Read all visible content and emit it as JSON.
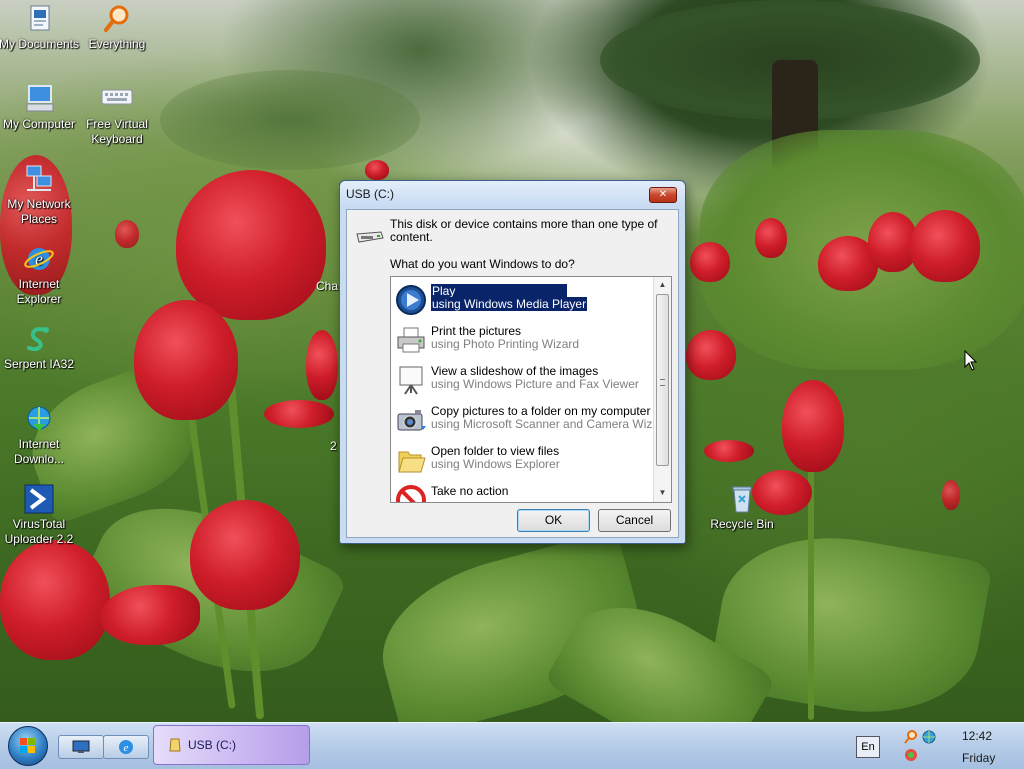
{
  "desktop": {
    "icons": [
      {
        "label": "My Documents",
        "icon": "documents-icon"
      },
      {
        "label": "Everything",
        "icon": "magnifier-icon"
      },
      {
        "label": "My Computer",
        "icon": "computer-icon"
      },
      {
        "label": "Free Virtual Keyboard",
        "icon": "keyboard-icon"
      },
      {
        "label": "My Network Places",
        "icon": "network-icon"
      },
      {
        "label": "Internet Explorer",
        "icon": "ie-icon"
      },
      {
        "label": "Serpent IA32",
        "icon": "serpent-icon"
      },
      {
        "label": "Internet Downlo...",
        "icon": "download-manager-icon"
      },
      {
        "label": "VirusTotal Uploader 2.2",
        "icon": "virustotal-icon"
      },
      {
        "label": "Recycle Bin",
        "icon": "recycle-bin-icon"
      }
    ],
    "partial_labels": [
      "Cha",
      "2"
    ]
  },
  "dialog": {
    "title": "USB (C:)",
    "close_label": "✕",
    "intro": "This disk or device contains more than one type of content.",
    "question": "What do you want Windows to do?",
    "actions": [
      {
        "title": "Play",
        "subtitle": "using Windows Media Player",
        "icon": "media-player-icon",
        "selected": true
      },
      {
        "title": "Print the pictures",
        "subtitle": "using Photo Printing Wizard",
        "icon": "printer-icon",
        "selected": false
      },
      {
        "title": "View a slideshow of the images",
        "subtitle": "using Windows Picture and Fax Viewer",
        "icon": "slideshow-icon",
        "selected": false
      },
      {
        "title": "Copy pictures to a folder on my computer",
        "subtitle": "using Microsoft Scanner and Camera Wizard",
        "icon": "camera-icon",
        "selected": false
      },
      {
        "title": "Open folder to view files",
        "subtitle": "using Windows Explorer",
        "icon": "folder-icon",
        "selected": false
      },
      {
        "title": "Take no action",
        "subtitle": "",
        "icon": "no-action-icon",
        "selected": false
      }
    ],
    "ok_label": "OK",
    "cancel_label": "Cancel"
  },
  "taskbar": {
    "task_label": "USB (C:)",
    "language": "En",
    "clock_time": "12:42",
    "clock_day": "Friday"
  },
  "colors": {
    "selection": "#0a246a",
    "titlebar": "#c6daf2",
    "taskbar": "#b7cde8"
  }
}
